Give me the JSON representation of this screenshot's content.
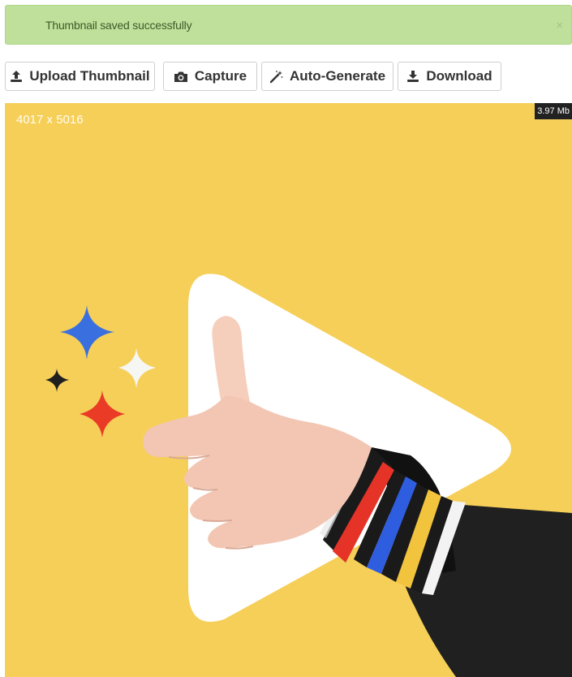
{
  "alert": {
    "message": "Thumbnail saved successfully",
    "close": "×",
    "color": "#bfe09a"
  },
  "toolbar": {
    "upload": {
      "label": "Upload Thumbnail",
      "icon": "upload-icon"
    },
    "capture": {
      "label": "Capture",
      "icon": "camera-icon"
    },
    "auto": {
      "label": "Auto-Generate",
      "icon": "magic-wand-icon"
    },
    "download": {
      "label": "Download",
      "icon": "download-icon"
    }
  },
  "preview": {
    "dimensions": "4017 x 5016",
    "file_size": "3.97 Mb",
    "background_color": "#f6cf58"
  }
}
